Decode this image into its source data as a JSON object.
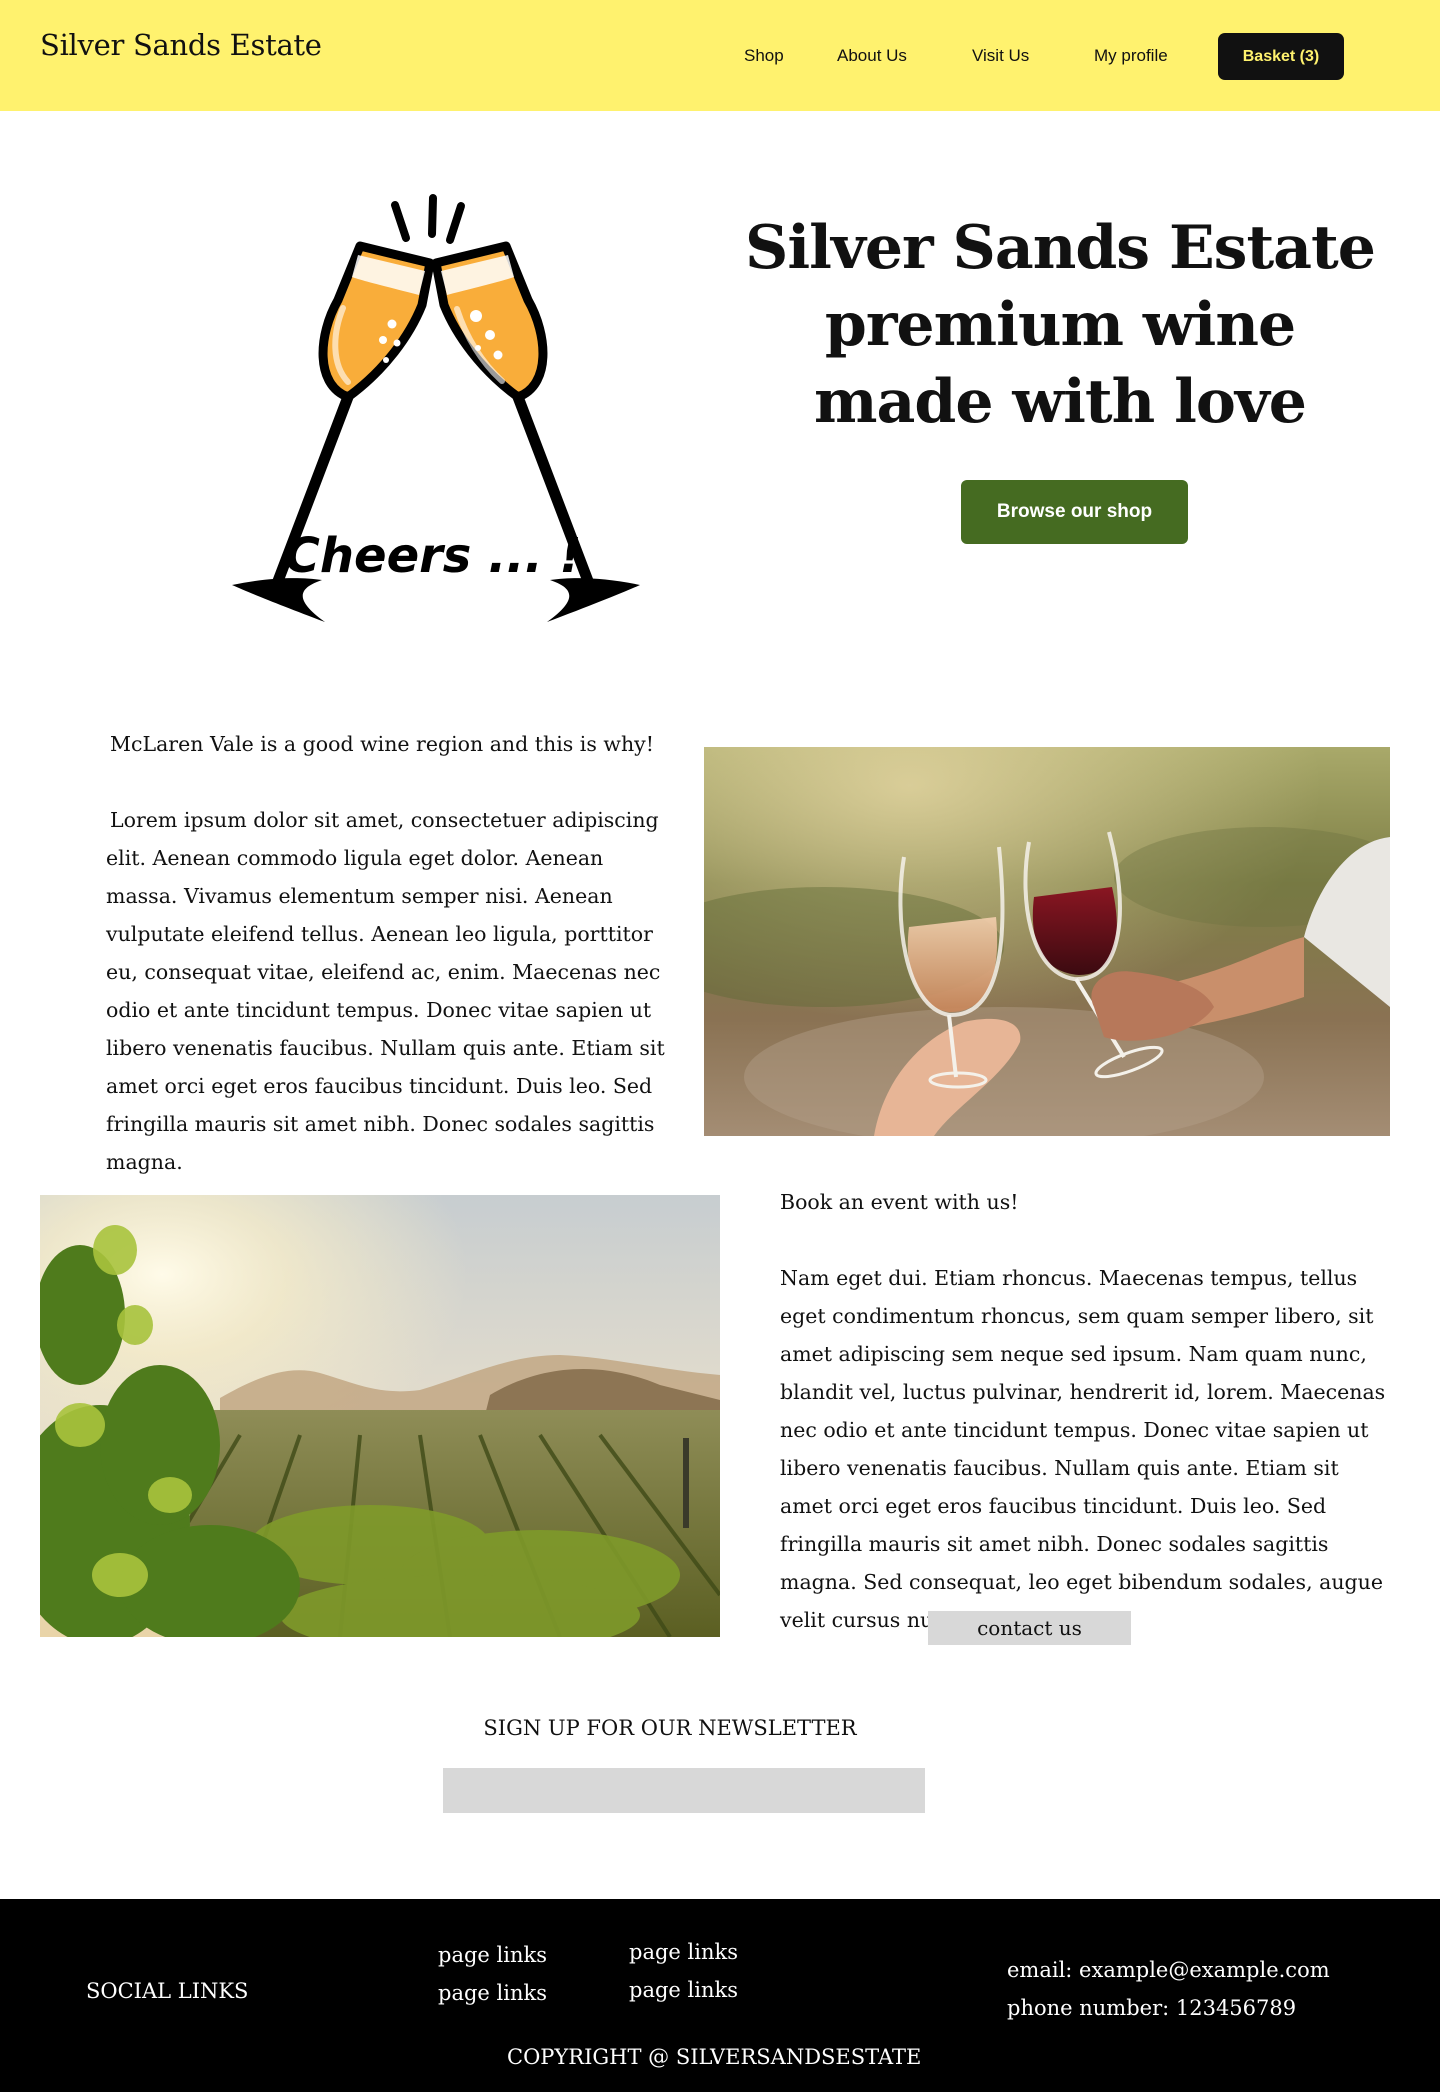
{
  "header": {
    "brand": "Silver Sands Estate",
    "nav": [
      "Shop",
      "About Us",
      "Visit Us",
      "My profile"
    ],
    "basket_label": "Basket (3)"
  },
  "hero": {
    "illustration_text": "Cheers ... !",
    "title": "Silver Sands Estate premium wine made with love",
    "cta_label": "Browse our shop"
  },
  "region_section": {
    "heading": "McLaren Vale is a good wine region and this is why!",
    "body": "Lorem ipsum dolor sit amet, consectetuer adipiscing elit. Aenean commodo ligula eget dolor. Aenean massa. Vivamus elementum semper nisi. Aenean vulputate eleifend tellus. Aenean leo ligula, porttitor eu, consequat vitae, eleifend ac, enim. Maecenas nec odio et ante tincidunt tempus. Donec vitae sapien ut libero venenatis faucibus. Nullam quis ante. Etiam sit amet orci eget eros faucibus tincidunt. Duis leo. Sed fringilla mauris sit amet nibh. Donec sodales sagittis magna."
  },
  "event_section": {
    "heading": "Book an event with us!",
    "body": "Nam eget dui. Etiam rhoncus. Maecenas tempus, tellus eget condimentum rhoncus, sem quam semper libero, sit amet adipiscing sem neque sed ipsum. Nam quam nunc, blandit vel, luctus pulvinar, hendrerit id, lorem. Maecenas nec odio et ante tincidunt tempus. Donec vitae sapien ut libero venenatis faucibus. Nullam quis ante. Etiam sit amet orci eget eros faucibus tincidunt. Duis leo. Sed fringilla mauris sit amet nibh. Donec sodales sagittis magna. Sed consequat, leo eget bibendum sodales, augue velit cursus nunc,",
    "contact_label": "contact us"
  },
  "newsletter": {
    "title": "SIGN UP FOR OUR NEWSLETTER",
    "placeholder": ""
  },
  "footer": {
    "social": "SOCIAL LINKS",
    "page_links": [
      "page links",
      "page links",
      "page links",
      "page links"
    ],
    "email": "email: example@example.com",
    "phone": "phone number: 123456789",
    "copyright": "COPYRIGHT @ SILVERSANDSESTATE"
  },
  "colors": {
    "header_bg": "#fff26e",
    "cta_bg": "#456b21",
    "basket_bg": "#111111",
    "footer_bg": "#000000",
    "wine_gold": "#f9ad3a"
  }
}
